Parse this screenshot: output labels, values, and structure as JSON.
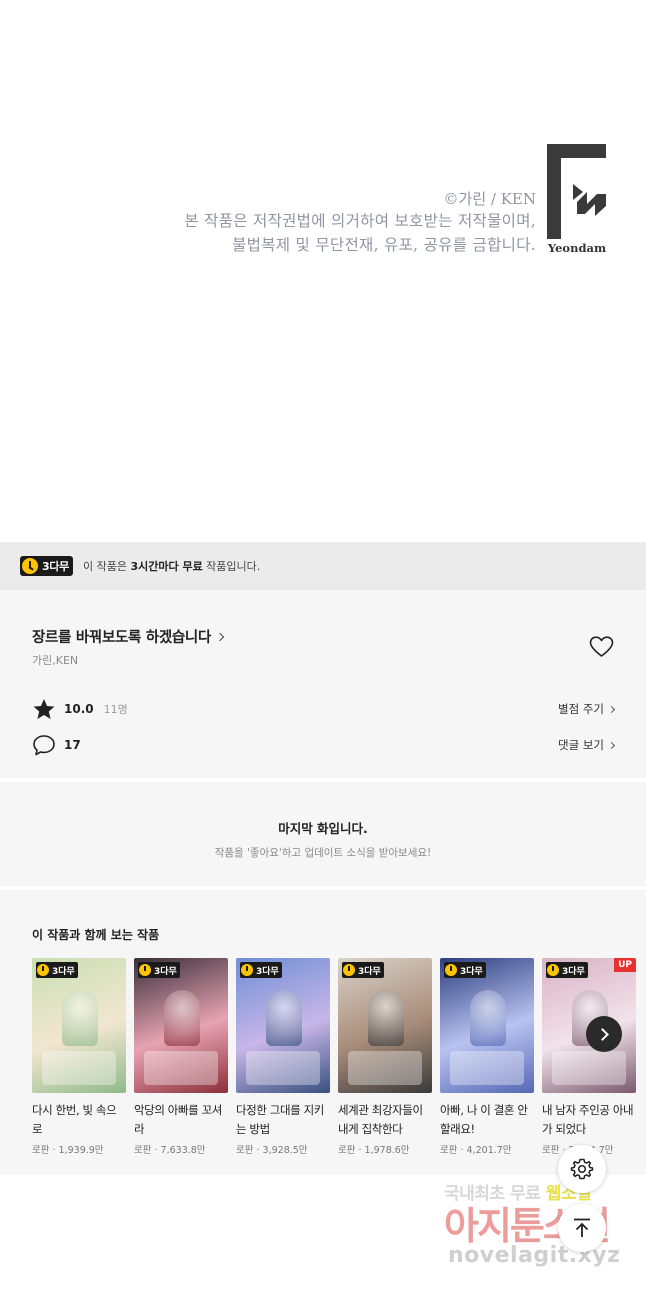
{
  "copyright": {
    "credit": "©가린 / KEN",
    "line1": "본 작품은 저작권법에 의거하여 보호받는 저작물이며,",
    "line2": "불법복제 및 무단전재, 유포, 공유를 금합니다.",
    "logo_text": "Yeondam"
  },
  "free_banner": {
    "badge": "3다무",
    "message_prefix": "이 작품은 ",
    "message_bold": "3시간마다 무료",
    "message_suffix": " 작품입니다."
  },
  "work": {
    "title": "장르를 바꿔보도록 하겠습니다",
    "author": "가린,KEN",
    "rating": "10.0",
    "rating_count": "11명",
    "rate_link": "별점 주기",
    "comment_count": "17",
    "comment_link": "댓글 보기"
  },
  "last_episode": {
    "title": "마지막 화입니다.",
    "subtitle": "작품을 '좋아요'하고 업데이트 소식을 받아보세요!"
  },
  "recommendations": {
    "heading": "이 작품과 함께 보는 작품",
    "items": [
      {
        "title": "다시 한번, 빛 속으로",
        "meta": "로판 · 1,939.9만",
        "badge": "3다무",
        "up": "",
        "colors": [
          "#c9dfb2",
          "#f2e6d0",
          "#8fb98a"
        ]
      },
      {
        "title": "악당의 아빠를 꼬셔라",
        "meta": "로판 · 7,633.8만",
        "badge": "3다무",
        "up": "",
        "colors": [
          "#3a2f3a",
          "#e7a3b3",
          "#8c2f3a"
        ]
      },
      {
        "title": "다정한 그대를 지키는 방법",
        "meta": "로판 · 3,928.5만",
        "badge": "3다무",
        "up": "",
        "colors": [
          "#6f8fd6",
          "#c7b6e8",
          "#38507f"
        ]
      },
      {
        "title": "세계관 최강자들이 내게 집착한다",
        "meta": "로판 · 1,978.6만",
        "badge": "3다무",
        "up": "",
        "colors": [
          "#d9d2c8",
          "#a88c7a",
          "#3a3a3a"
        ]
      },
      {
        "title": "아빠, 나 이 결혼 안 할래요!",
        "meta": "로판 · 4,201.7만",
        "badge": "3다무",
        "up": "",
        "colors": [
          "#2e3e7e",
          "#b8c3f0",
          "#5667b5"
        ]
      },
      {
        "title": "내 남자 주인공 아내가 되었다",
        "meta": "로판 · 2,504.7만",
        "badge": "3다무",
        "up": "UP",
        "colors": [
          "#d8b3c4",
          "#f2e2ea",
          "#7a5a6e"
        ]
      }
    ]
  },
  "watermark": {
    "line1a": "국내최초 무료 ",
    "line1b": "웹소설",
    "line2": "아지툰소설",
    "line3": "novelagit.xyz"
  },
  "icons": {
    "clock": "clock-icon",
    "heart": "heart-icon",
    "star": "star-icon",
    "comment": "comment-icon",
    "settings": "gear-icon",
    "scroll_top": "arrow-up-icon",
    "next": "chevron-right-icon"
  },
  "colors": {
    "badge_yellow": "#ffc400",
    "up_red": "#e8302e",
    "panel_bg": "#f6f6f6",
    "banner_bg": "#ebebeb"
  }
}
